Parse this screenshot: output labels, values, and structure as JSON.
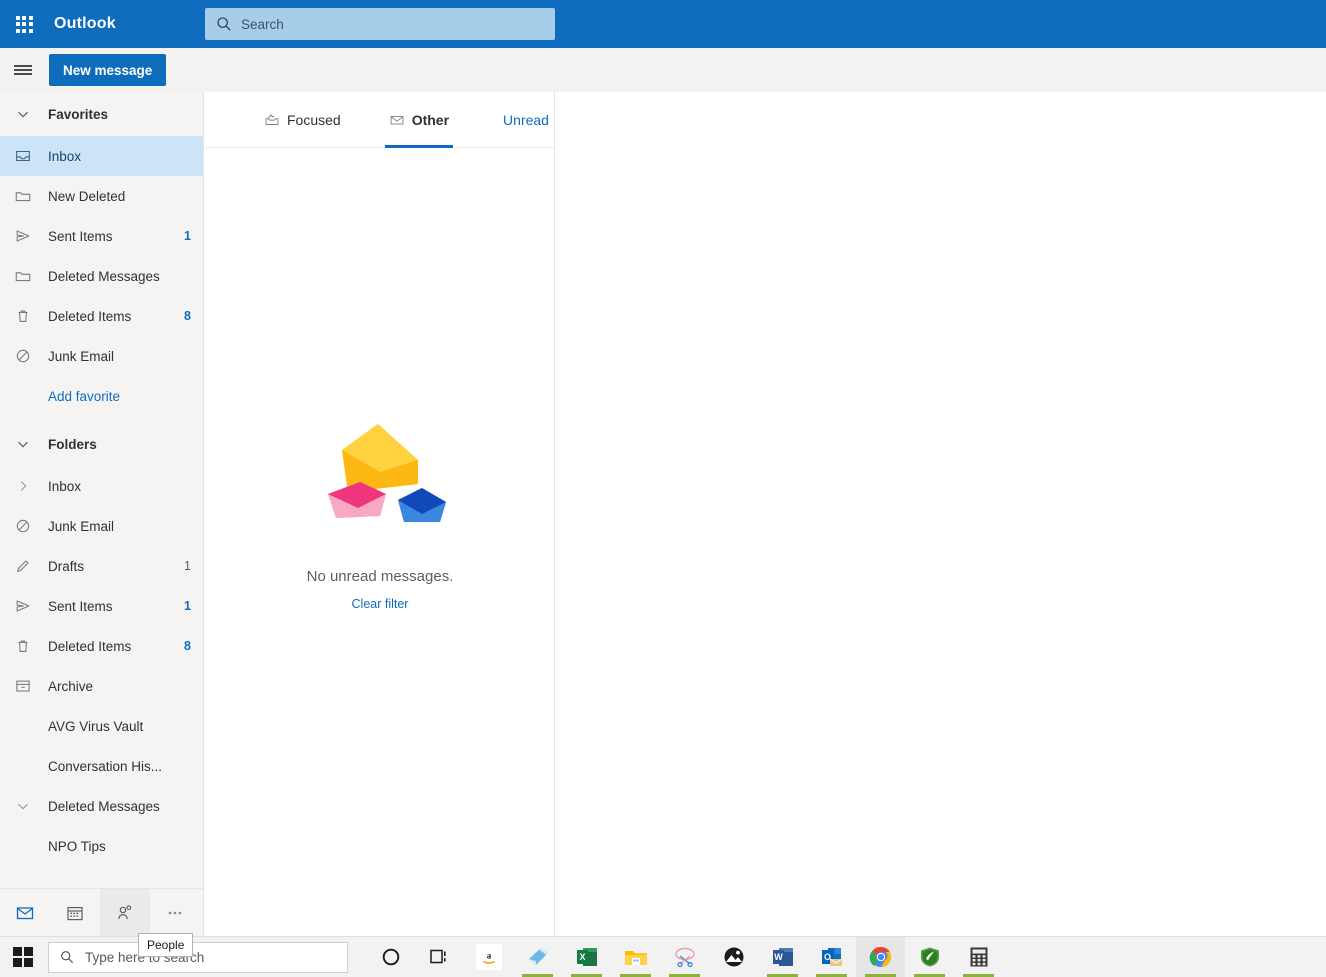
{
  "app": {
    "brand": "Outlook",
    "accent": "#0f6cbd",
    "header_bg": "#0f6cbd",
    "search_bg": "#a6cdea",
    "sidebar_bg": "#f5f4f2",
    "selected_bg": "#cce4f7"
  },
  "header": {
    "waffle_icon": "app-launcher-waffle-icon",
    "search": {
      "value": "",
      "placeholder": "Search",
      "icon": "search-icon"
    }
  },
  "commandbar": {
    "menu_icon": "hamburger-menu-icon",
    "new_message_label": "New message"
  },
  "sidebar": {
    "favorites": {
      "label": "Favorites",
      "chevron": "chevron-down-icon",
      "items": [
        {
          "label": "Inbox",
          "icon": "inbox-icon",
          "count": "",
          "selected": true
        },
        {
          "label": "New Deleted",
          "icon": "folder-icon",
          "count": "",
          "selected": false
        },
        {
          "label": "Sent Items",
          "icon": "send-icon",
          "count": "1",
          "selected": false
        },
        {
          "label": "Deleted Messages",
          "icon": "folder-icon",
          "count": "",
          "selected": false
        },
        {
          "label": "Deleted Items",
          "icon": "trash-icon",
          "count": "8",
          "selected": false
        },
        {
          "label": "Junk Email",
          "icon": "block-icon",
          "count": "",
          "selected": false
        },
        {
          "label": "Add favorite",
          "icon": "none",
          "count": "",
          "selected": false,
          "link": true
        }
      ]
    },
    "folders": {
      "label": "Folders",
      "chevron": "chevron-down-icon",
      "items": [
        {
          "label": "Inbox",
          "icon": "chevron-right-icon",
          "count": "",
          "indent": false
        },
        {
          "label": "Junk Email",
          "icon": "block-icon",
          "count": "",
          "indent": false
        },
        {
          "label": "Drafts",
          "icon": "pencil-icon",
          "count": "1",
          "count_grey": true,
          "indent": false
        },
        {
          "label": "Sent Items",
          "icon": "send-icon",
          "count": "1",
          "indent": false
        },
        {
          "label": "Deleted Items",
          "icon": "trash-icon",
          "count": "8",
          "indent": false
        },
        {
          "label": "Archive",
          "icon": "archive-icon",
          "count": "",
          "indent": false
        },
        {
          "label": "AVG Virus Vault",
          "icon": "none",
          "count": "",
          "indent": false
        },
        {
          "label": "Conversation His...",
          "icon": "none",
          "count": "",
          "indent": false
        },
        {
          "label": "Deleted Messages",
          "icon": "chevron-down-icon",
          "count": "",
          "indent": false
        },
        {
          "label": "NPO Tips",
          "icon": "none",
          "count": "",
          "indent": true
        }
      ]
    },
    "appnav": [
      {
        "name": "mail-icon",
        "active": true,
        "hover": false
      },
      {
        "name": "calendar-icon",
        "active": false,
        "hover": false
      },
      {
        "name": "people-icon",
        "active": false,
        "hover": true
      },
      {
        "name": "more-options-icon",
        "active": false,
        "hover": false
      }
    ],
    "tooltip": "People"
  },
  "messagelist": {
    "pivots": [
      {
        "label": "Focused",
        "icon": "focused-inbox-icon",
        "active": false
      },
      {
        "label": "Other",
        "icon": "other-inbox-icon",
        "active": true
      }
    ],
    "filter": {
      "label": "Unread",
      "close_icon": "close-icon"
    },
    "empty": {
      "illustration": "envelopes-illustration",
      "title": "No unread messages.",
      "clear_label": "Clear filter"
    }
  },
  "taskbar": {
    "start_icon": "windows-start-icon",
    "search": {
      "placeholder": "Type here to search",
      "icon": "search-icon"
    },
    "icons": [
      {
        "name": "cortana-icon",
        "running": false,
        "active": false
      },
      {
        "name": "task-view-icon",
        "running": false,
        "active": false
      },
      {
        "name": "amazon-icon",
        "running": false,
        "active": false
      },
      {
        "name": "sticky-notes-icon",
        "running": true,
        "active": false
      },
      {
        "name": "excel-icon",
        "running": true,
        "active": false
      },
      {
        "name": "file-explorer-icon",
        "running": true,
        "active": false
      },
      {
        "name": "snipping-tool-icon",
        "running": true,
        "active": false
      },
      {
        "name": "photos-icon",
        "running": false,
        "active": false
      },
      {
        "name": "word-icon",
        "running": true,
        "active": false
      },
      {
        "name": "outlook-icon",
        "running": true,
        "active": false
      },
      {
        "name": "chrome-icon",
        "running": true,
        "active": true
      },
      {
        "name": "avg-icon",
        "running": true,
        "active": false
      },
      {
        "name": "calculator-icon",
        "running": true,
        "active": false
      }
    ]
  }
}
